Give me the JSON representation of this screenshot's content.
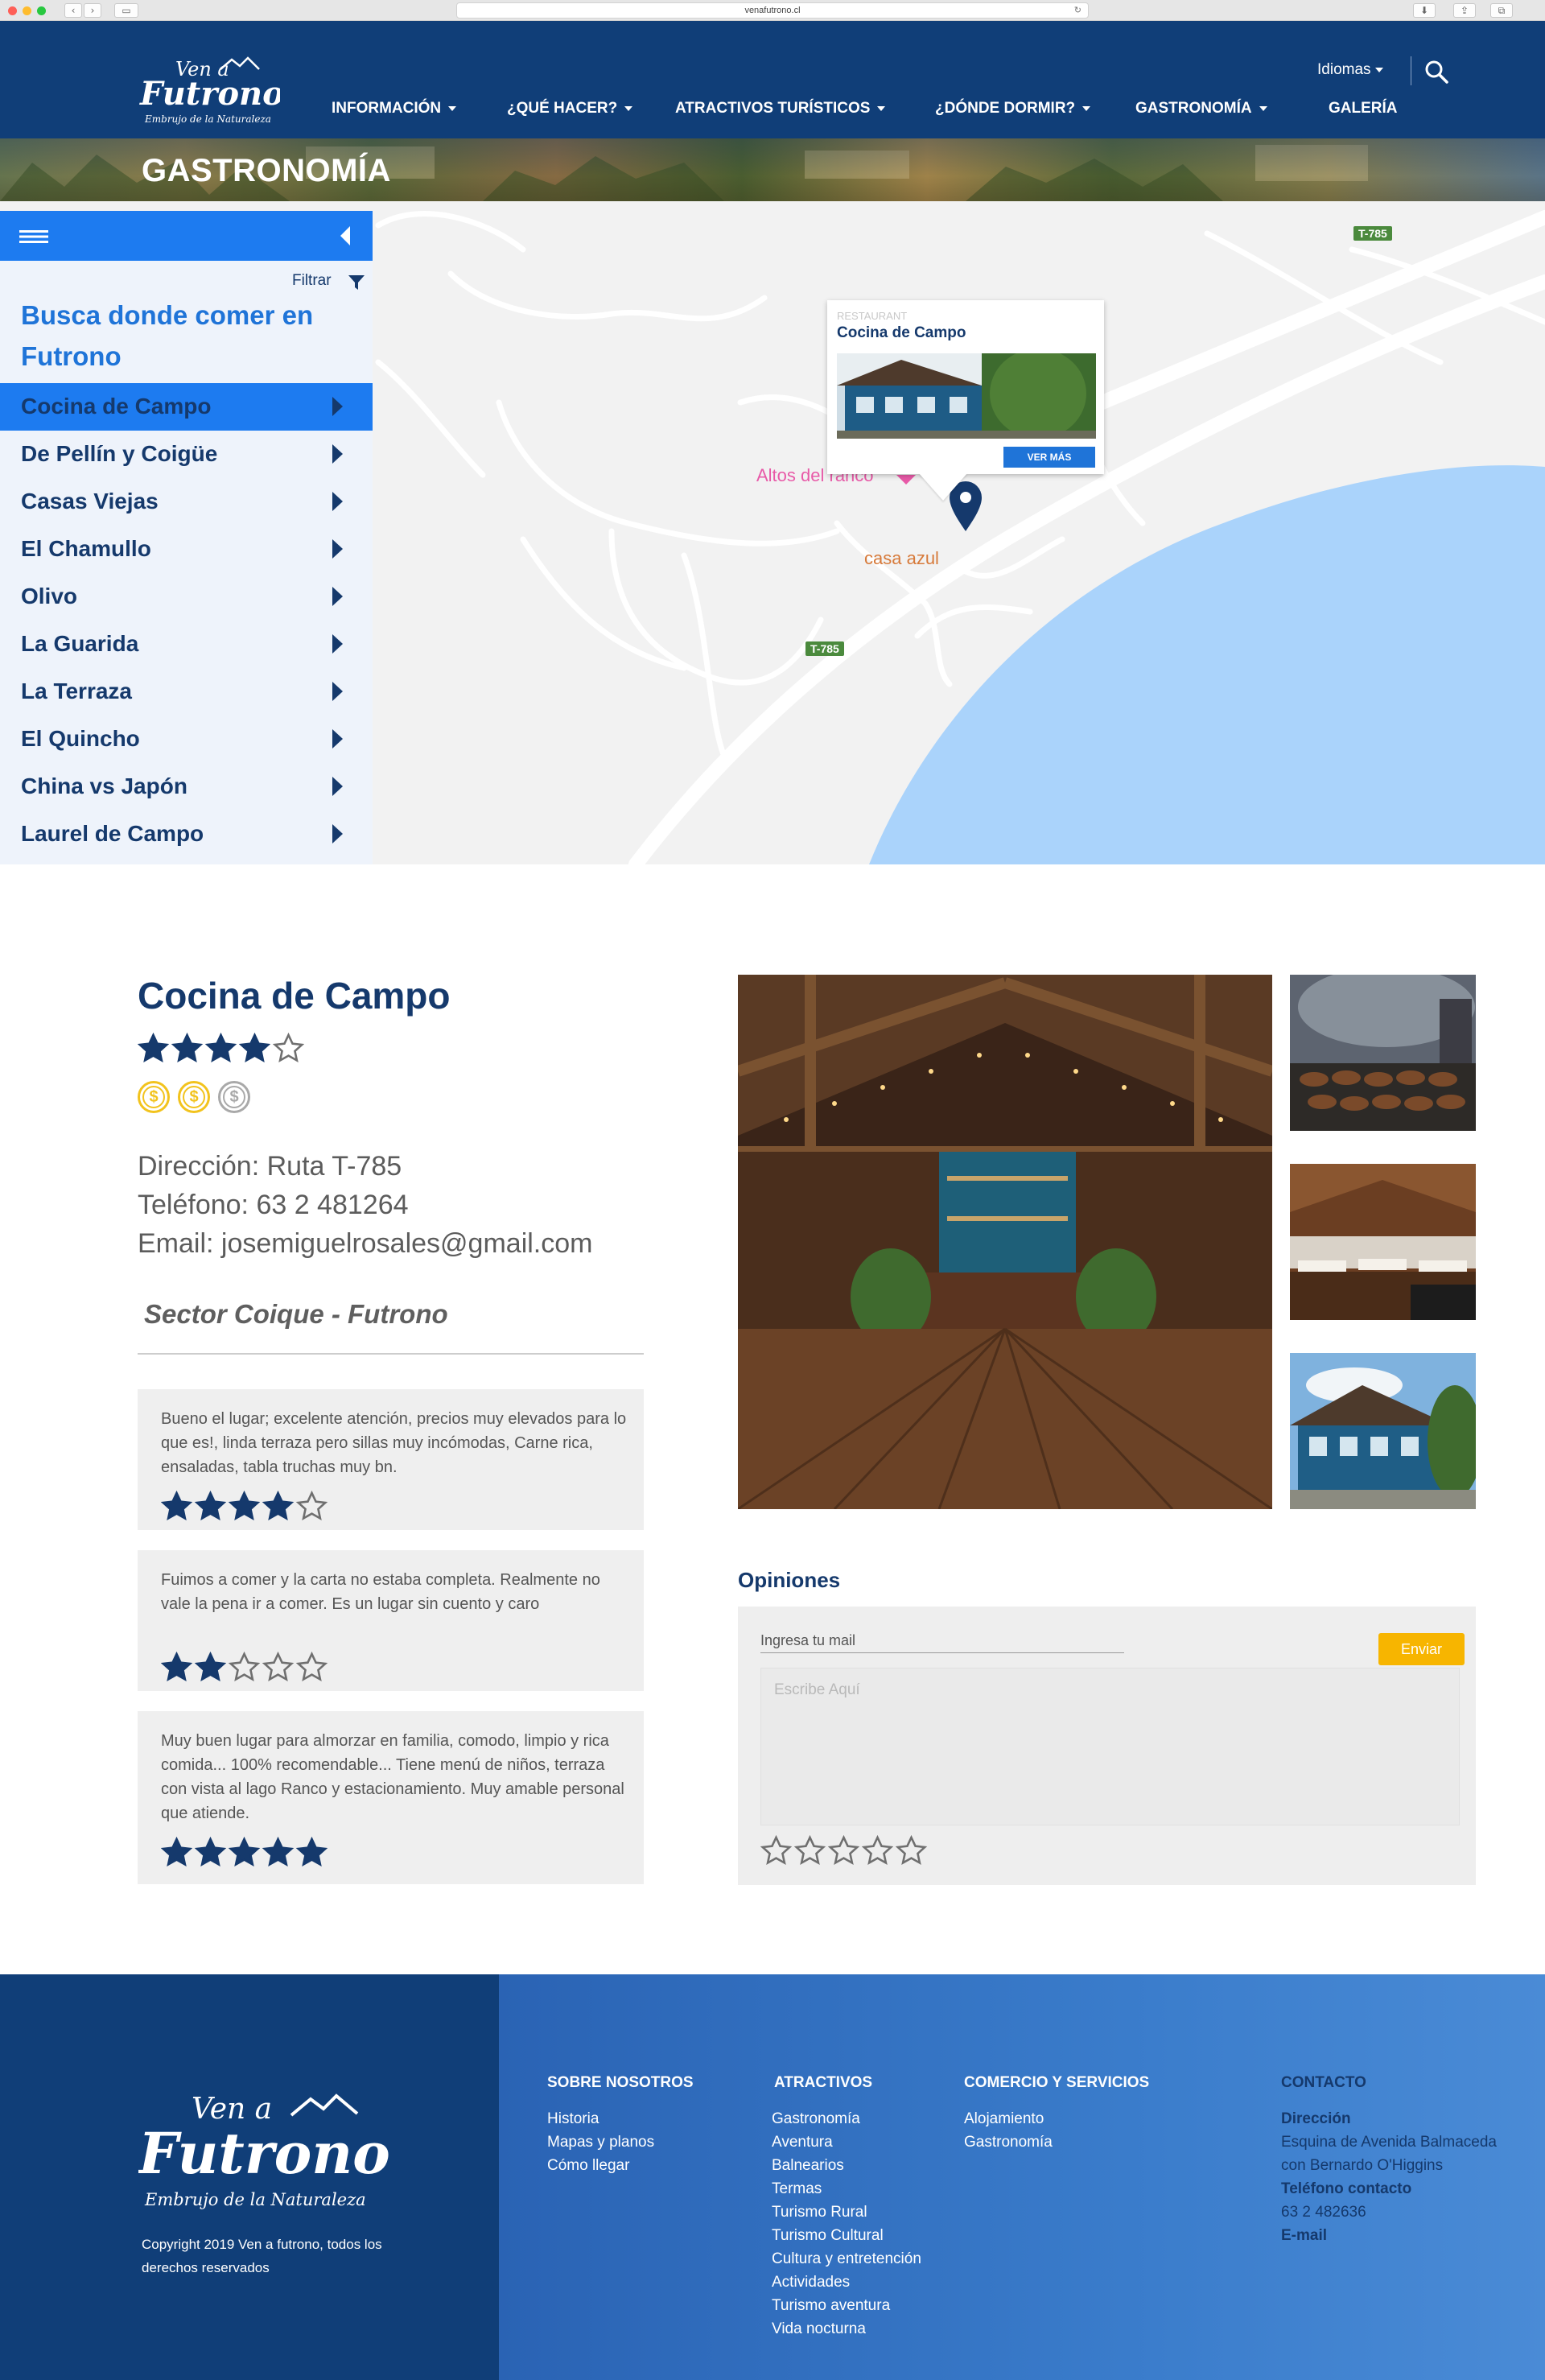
{
  "browser": {
    "url": "venafutrono.cl"
  },
  "header": {
    "logo_text": "Ven a Futrono",
    "logo_tagline": "Embrujo de la Naturaleza",
    "nav": [
      {
        "label": "INFORMACIÓN",
        "dropdown": true
      },
      {
        "label": "¿QUÉ HACER?",
        "dropdown": true
      },
      {
        "label": "ATRACTIVOS TURÍSTICOS",
        "dropdown": true
      },
      {
        "label": "¿DÓNDE DORMIR?",
        "dropdown": true
      },
      {
        "label": "GASTRONOMÍA",
        "dropdown": true
      },
      {
        "label": "GALERÍA",
        "dropdown": false
      }
    ],
    "language_label": "Idiomas"
  },
  "banner": {
    "title": "GASTRONOMÍA"
  },
  "map": {
    "road_labels": [
      "T-785",
      "T-785"
    ],
    "poi_labels": [
      "Altos del ranco",
      "casa azul"
    ],
    "popup": {
      "category": "RESTAURANT",
      "name": "Cocina de Campo",
      "button": "VER MÁS"
    }
  },
  "sidebar": {
    "filter_label": "Filtrar",
    "title": "Busca donde comer en Futrono",
    "items": [
      {
        "label": "Cocina de Campo",
        "active": true
      },
      {
        "label": "De Pellín y Coigüe",
        "active": false
      },
      {
        "label": "Casas Viejas",
        "active": false
      },
      {
        "label": "El Chamullo",
        "active": false
      },
      {
        "label": "Olivo",
        "active": false
      },
      {
        "label": "La Guarida",
        "active": false
      },
      {
        "label": "La Terraza",
        "active": false
      },
      {
        "label": "El Quincho",
        "active": false
      },
      {
        "label": "China vs Japón",
        "active": false
      },
      {
        "label": "Laurel de Campo",
        "active": false
      }
    ]
  },
  "restaurant": {
    "name": "Cocina de Campo",
    "rating": 4,
    "rating_max": 5,
    "price_level": 2,
    "price_max": 3,
    "address": "Dirección: Ruta T-785",
    "phone": "Teléfono:  63 2 481264",
    "email": "Email: josemiguelrosales@gmail.com",
    "sector": "Sector Coique - Futrono"
  },
  "reviews": [
    {
      "text": "Bueno el lugar; excelente atención, precios muy elevados para lo que es!, linda terraza pero sillas muy incómodas, Carne rica, ensaladas, tabla truchas muy bn.",
      "rating": 4
    },
    {
      "text": "Fuimos a comer y la carta no estaba completa. Realmente no vale la pena ir a comer. Es un lugar sin cuento y caro",
      "rating": 2
    },
    {
      "text": "Muy buen lugar para almorzar en familia, comodo, limpio y rica comida... 100% recomendable... Tiene menú de niños, terraza con vista al lago Ranco y estacionamiento. Muy amable personal que atiende.",
      "rating": 5
    }
  ],
  "opinions": {
    "title": "Opiniones",
    "email_label": "Ingresa tu mail",
    "send_label": "Enviar",
    "text_placeholder": "Escribe Aquí",
    "rating": 0
  },
  "footer": {
    "copyright": "Copyright 2019 Ven a futrono, todos los derechos reservados",
    "columns": [
      {
        "title": "SOBRE NOSOTROS",
        "items": [
          "Historia",
          "Mapas y planos",
          "Cómo llegar"
        ]
      },
      {
        "title": "ATRACTIVOS",
        "items": [
          "Gastronomía",
          "Aventura",
          "Balnearios",
          "Termas",
          "Turismo Rural",
          "Turismo Cultural",
          "Cultura y entretención",
          "Actividades",
          "Turismo aventura",
          "Vida nocturna"
        ]
      },
      {
        "title": "COMERCIO Y SERVICIOS",
        "items": [
          "Alojamiento",
          "Gastronomía"
        ]
      }
    ],
    "contact": {
      "title": "CONTACTO",
      "address_title": "Dirección",
      "address": "Esquina de Avenida Balmaceda con Bernardo O'Higgins",
      "phone_title": "Teléfono contacto",
      "phone": "63 2 482636",
      "email_title": "E-mail"
    }
  },
  "colors": {
    "brand_navy": "#103e78",
    "accent_blue": "#1d7bf0",
    "star": "#15396c",
    "coin": "#f2c31d",
    "send_button": "#f7b500"
  }
}
